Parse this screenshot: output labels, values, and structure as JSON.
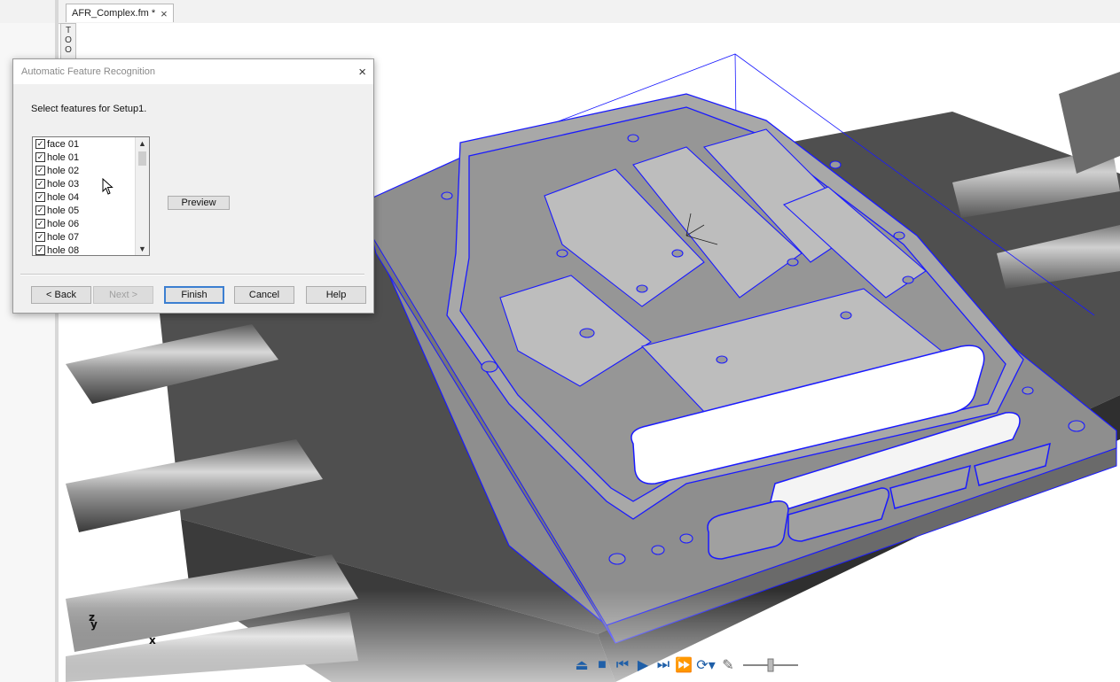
{
  "window": {
    "tab_title": "AFR_Complex.fm *",
    "tab_close": "×",
    "tools_tab": "TOO"
  },
  "viewport": {
    "axis_labels": {
      "z": "z",
      "y": "y",
      "x": "x"
    },
    "wire_color": "#1a1aff",
    "playbar_icons": [
      "eject-icon",
      "stop-icon",
      "step-back-icon",
      "play-icon",
      "step-forward-icon",
      "fast-forward-icon",
      "loop-dropdown-icon",
      "marker-pen-icon",
      "speed-slider"
    ]
  },
  "dialog": {
    "title": "Automatic Feature Recognition",
    "close": "×",
    "prompt": "Select features for Setup1.",
    "features": [
      {
        "label": "face 01",
        "checked": true
      },
      {
        "label": "hole 01",
        "checked": true
      },
      {
        "label": "hole 02",
        "checked": true
      },
      {
        "label": "hole 03",
        "checked": true
      },
      {
        "label": "hole 04",
        "checked": true
      },
      {
        "label": "hole 05",
        "checked": true
      },
      {
        "label": "hole 06",
        "checked": true
      },
      {
        "label": "hole 07",
        "checked": true
      },
      {
        "label": "hole 08",
        "checked": true
      }
    ],
    "preview_label": "Preview",
    "buttons": {
      "back": "< Back",
      "next": "Next >",
      "finish": "Finish",
      "cancel": "Cancel",
      "help": "Help"
    }
  }
}
